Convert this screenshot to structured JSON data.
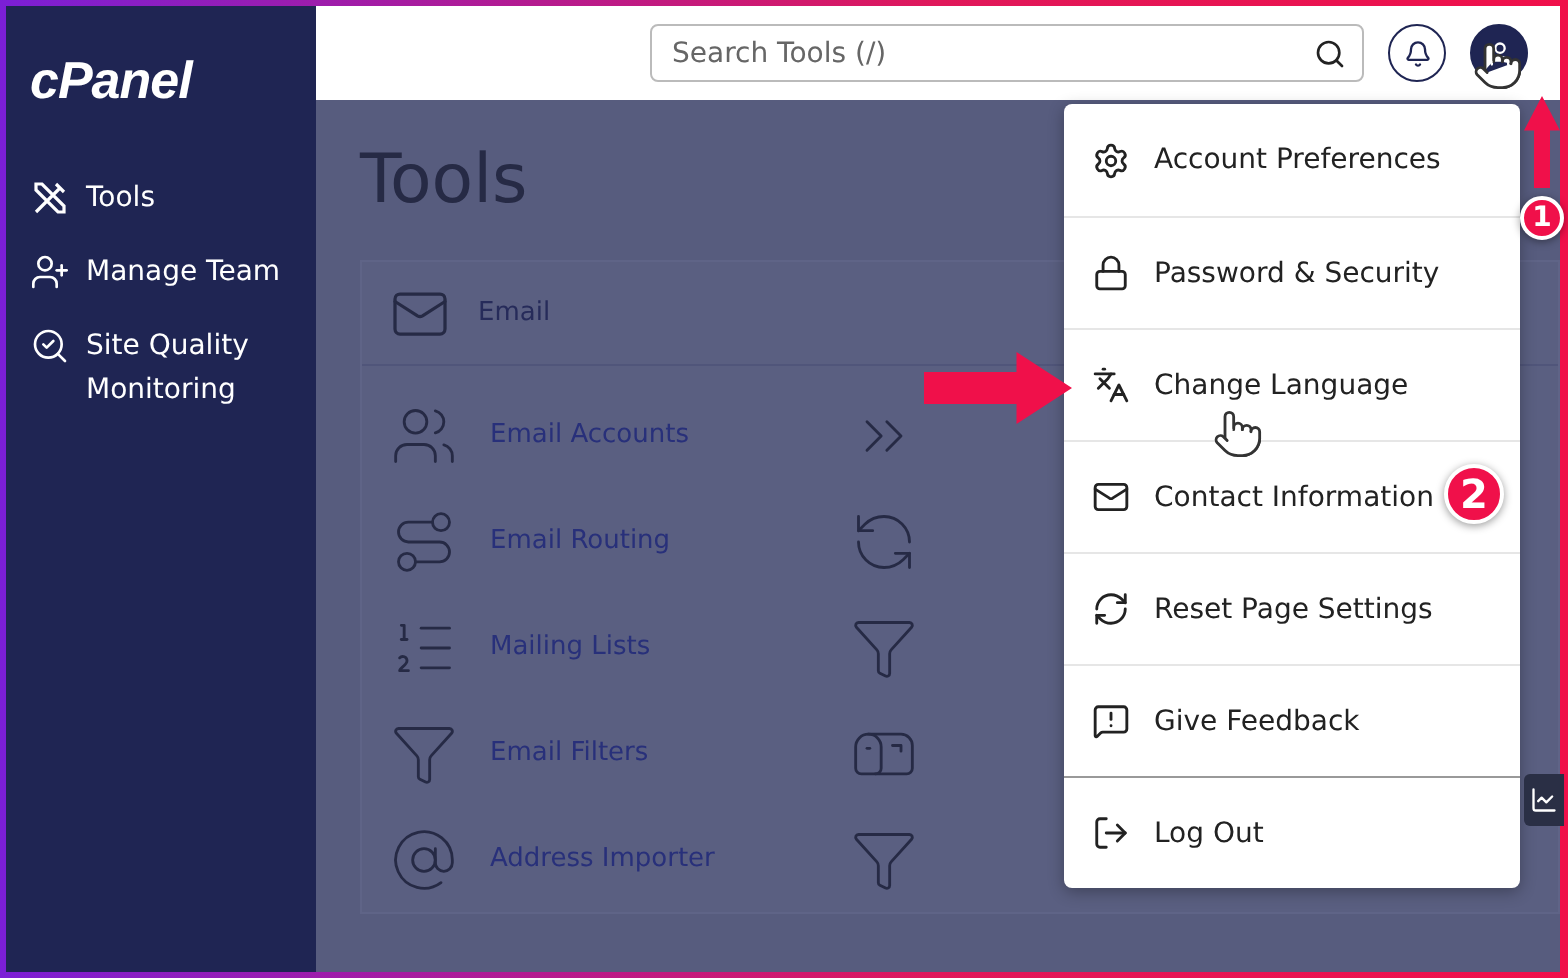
{
  "sidebar": {
    "logo": "cPanel",
    "items": [
      {
        "label": "Tools"
      },
      {
        "label": "Manage Team"
      },
      {
        "label": "Site Quality Monitoring"
      }
    ]
  },
  "header": {
    "search": {
      "placeholder": "Search Tools (/)"
    }
  },
  "page": {
    "title": "Tools",
    "section": {
      "title": "Email",
      "tools": [
        {
          "label": "Email Accounts"
        },
        {
          "label": "Email Routing"
        },
        {
          "label": "Mailing Lists"
        },
        {
          "label": "Email Filters"
        },
        {
          "label": "Address Importer"
        }
      ]
    }
  },
  "user_menu": {
    "items": [
      {
        "label": "Account Preferences"
      },
      {
        "label": "Password & Security"
      },
      {
        "label": "Change Language"
      },
      {
        "label": "Contact Information"
      },
      {
        "label": "Reset Page Settings"
      },
      {
        "label": "Give Feedback"
      },
      {
        "label": "Log Out"
      }
    ]
  },
  "annotations": [
    {
      "number": "1"
    },
    {
      "number": "2"
    }
  ]
}
